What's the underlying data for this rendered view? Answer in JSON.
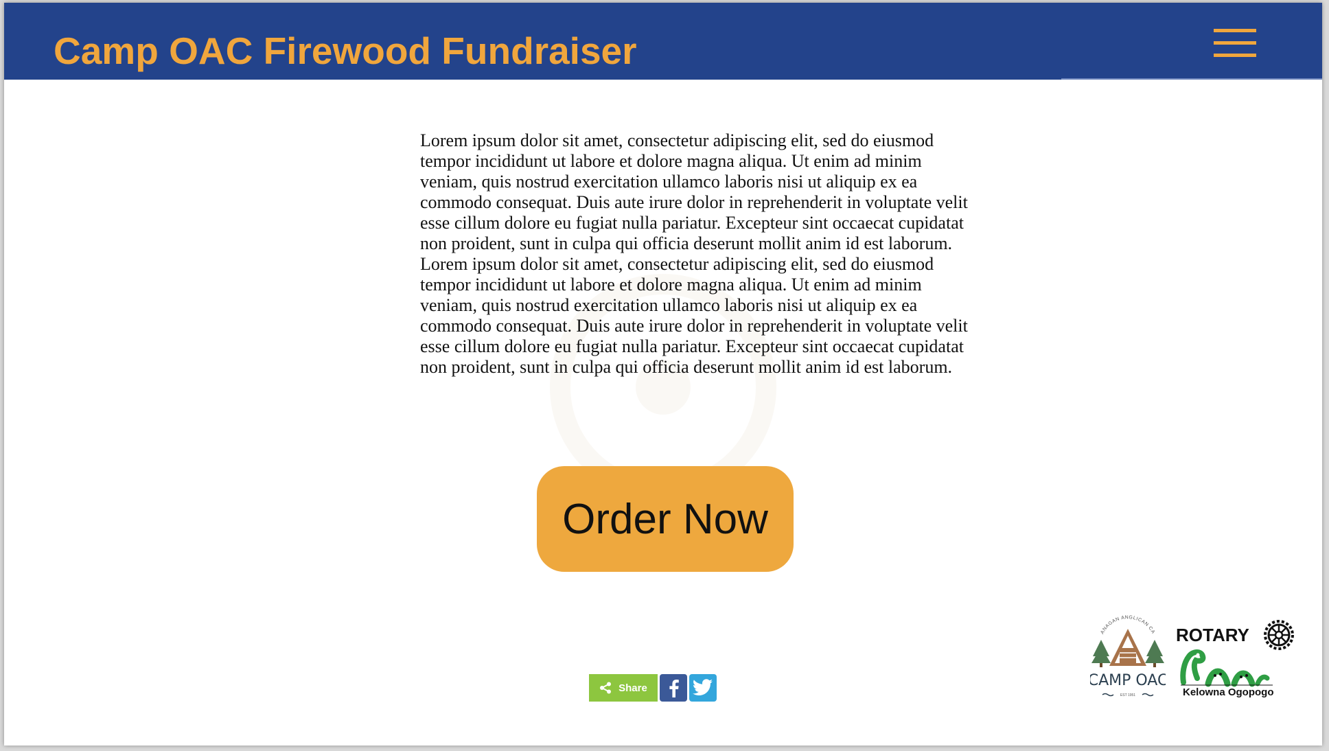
{
  "header": {
    "title": "Camp OAC Firewood Fundraiser",
    "menu_icon": "hamburger-menu-icon"
  },
  "main": {
    "intro_text": "Lorem ipsum dolor sit amet, consectetur adipiscing elit, sed do eiusmod tempor incididunt ut labore et dolore magna aliqua. Ut enim ad minim veniam, quis nostrud exercitation ullamco laboris nisi ut aliquip ex ea commodo consequat. Duis aute irure dolor in reprehenderit in voluptate velit esse cillum dolore eu fugiat nulla pariatur. Excepteur sint occaecat cupidatat non proident, sunt in culpa qui officia deserunt mollit anim id est laborum. Lorem ipsum dolor sit amet, consectetur adipiscing elit, sed do eiusmod tempor incididunt ut labore et dolore magna aliqua. Ut enim ad minim veniam, quis nostrud exercitation ullamco laboris nisi ut aliquip ex ea commodo consequat. Duis aute irure dolor in reprehenderit in voluptate velit esse cillum dolore eu fugiat nulla pariatur. Excepteur sint occaecat cupidatat non proident, sunt in culpa qui officia deserunt mollit anim id est laborum.",
    "order_button_label": "Order Now"
  },
  "share": {
    "share_label": "Share",
    "icons": [
      "share-icon",
      "facebook-icon",
      "twitter-icon"
    ]
  },
  "sponsors": {
    "camp_logo_arc_text": "OKANAGAN ANGLICAN CAMP",
    "camp_logo_name": "CAMP OAC",
    "camp_logo_est": "EST 1951",
    "rotary_title": "ROTARY",
    "rotary_caption": "Kelowna Ogopogo"
  },
  "colors": {
    "header_background": "#23438b",
    "accent_orange": "#f0a63d",
    "button_orange": "#eea83e",
    "share_green": "#8dc63f",
    "facebook_blue": "#3b5998",
    "twitter_blue": "#33a6dc",
    "forest_green": "#4e7a52",
    "ogopogo_green": "#2f9e44"
  }
}
